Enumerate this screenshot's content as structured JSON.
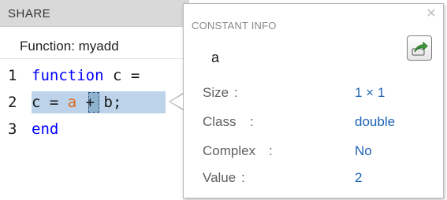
{
  "panel": {
    "tab_label": "SHARE",
    "function_header": "Function: myadd"
  },
  "code": {
    "line1": {
      "number": "1",
      "keyword": "function",
      "rest": " c ="
    },
    "line2": {
      "number": "2",
      "before": "c = ",
      "variable": "a",
      "after": " + b;"
    },
    "line3": {
      "number": "3",
      "keyword": "end"
    }
  },
  "popup": {
    "title": "CONSTANT INFO",
    "name": "a",
    "close_icon": "close-icon",
    "export_icon": "export-icon",
    "properties": [
      {
        "key": "Size",
        "value": "1 × 1"
      },
      {
        "key": "Class",
        "value": "double"
      },
      {
        "key": "Complex",
        "value": "No"
      },
      {
        "key": "Value",
        "value": "2"
      }
    ]
  },
  "colors": {
    "keyword": "#0000ff",
    "highlight": "#bcd3ea",
    "variable": "#e06a1c",
    "value_text": "#1e64b4"
  }
}
